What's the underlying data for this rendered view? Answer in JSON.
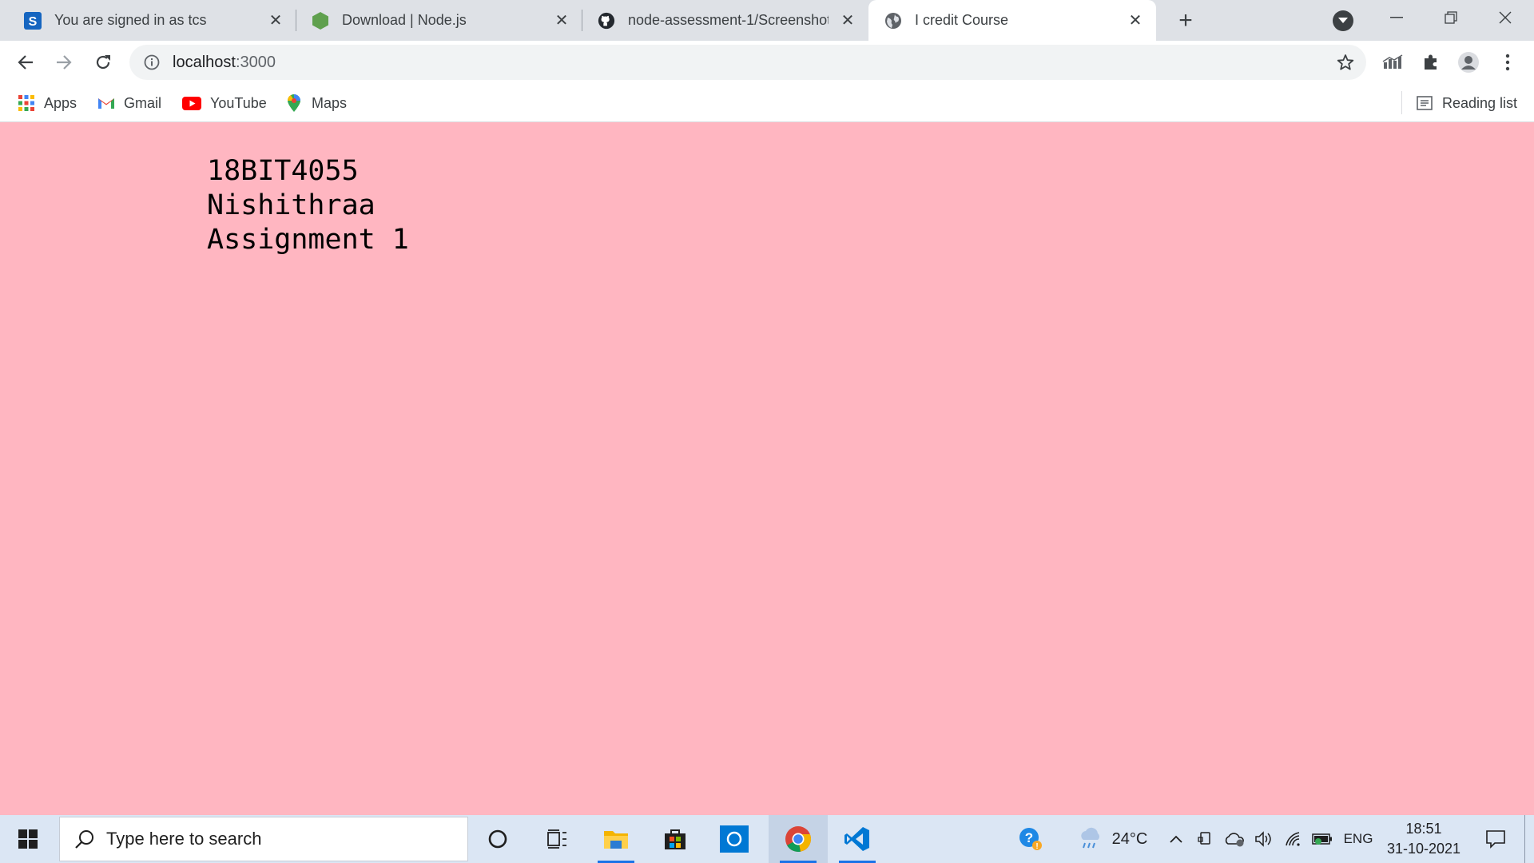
{
  "browser": {
    "tabs": [
      {
        "title": "You are signed in as tcs",
        "icon": "s-logo-icon"
      },
      {
        "title": "Download | Node.js",
        "icon": "nodejs-icon"
      },
      {
        "title": "node-assessment-1/Screenshot (",
        "icon": "github-icon"
      },
      {
        "title": "I credit Course",
        "icon": "globe-icon",
        "active": true
      }
    ],
    "address": {
      "host": "localhost",
      "port": ":3000"
    },
    "bookmarks": [
      {
        "label": "Apps",
        "icon": "apps-grid-icon"
      },
      {
        "label": "Gmail",
        "icon": "gmail-icon"
      },
      {
        "label": "YouTube",
        "icon": "youtube-icon"
      },
      {
        "label": "Maps",
        "icon": "maps-pin-icon"
      }
    ],
    "reading_list": "Reading list"
  },
  "page": {
    "lines": [
      "18BIT4055",
      "Nishithraa",
      "Assignment 1"
    ],
    "background": "#ffb6c1"
  },
  "taskbar": {
    "search_placeholder": "Type here to search",
    "weather": "24°C",
    "language": "ENG",
    "time": "18:51",
    "date": "31-10-2021"
  },
  "colors": {
    "tabstrip": "#dee1e6",
    "taskbar": "#dbe6f4",
    "accent": "#1a73e8"
  }
}
